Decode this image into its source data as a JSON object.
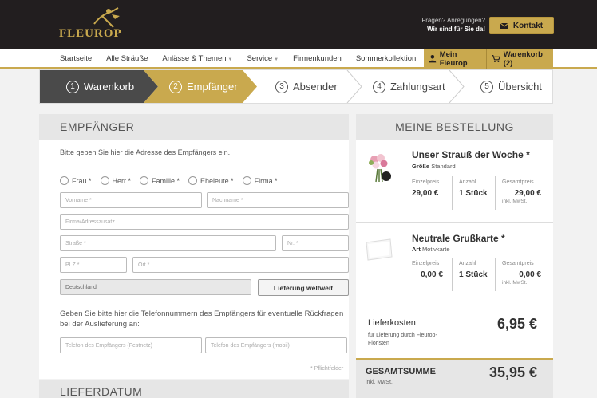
{
  "header": {
    "brand": "FLEUROP",
    "help_line1": "Fragen? Anregungen?",
    "help_line2": "Wir sind für Sie da!",
    "kontakt_label": "Kontakt"
  },
  "nav": {
    "items": [
      {
        "label": "Startseite"
      },
      {
        "label": "Alle Sträuße"
      },
      {
        "label": "Anlässe & Themen"
      },
      {
        "label": "Service"
      },
      {
        "label": "Firmenkunden"
      },
      {
        "label": "Sommerkollektion"
      }
    ],
    "my_account": "Mein Fleurop",
    "cart": "Warenkorb (2)"
  },
  "steps": [
    {
      "num": "1",
      "label": "Warenkorb",
      "state": "done"
    },
    {
      "num": "2",
      "label": "Empfänger",
      "state": "active"
    },
    {
      "num": "3",
      "label": "Absender",
      "state": "todo"
    },
    {
      "num": "4",
      "label": "Zahlungsart",
      "state": "todo"
    },
    {
      "num": "5",
      "label": "Übersicht",
      "state": "todo"
    }
  ],
  "recipient": {
    "heading": "EMPFÄNGER",
    "intro": "Bitte geben Sie hier die Adresse des Empfängers ein.",
    "salutations": [
      "Frau *",
      "Herr *",
      "Familie *",
      "Eheleute *",
      "Firma *"
    ],
    "placeholders": {
      "firstname": "Vorname *",
      "lastname": "Nachname *",
      "company": "Firma/Adresszusatz",
      "street": "Straße *",
      "number": "Nr. *",
      "zip": "PLZ *",
      "city": "Ort *",
      "phone": "Telefon des Empfängers (Festnetz)",
      "mobile": "Telefon des Empfängers (mobil)"
    },
    "country": "Deutschland",
    "worldwide_button": "Lieferung weltweit",
    "phone_text": "Geben Sie bitte hier die Telefonnummern des Empfängers für eventuelle Rückfragen bei der Auslieferung an:",
    "required_note": "* Pflichtfelder",
    "next_heading": "LIEFERDATUM"
  },
  "order": {
    "heading": "MEINE BESTELLUNG",
    "items": [
      {
        "name": "Unser Strauß der Woche *",
        "attr_label": "Größe",
        "attr_value": "Standard",
        "unit_price_label": "Einzelpreis",
        "unit_price": "29,00 €",
        "qty_label": "Anzahl",
        "qty": "1 Stück",
        "total_label": "Gesamtpreis",
        "total": "29,00 €",
        "tax": "inkl. MwSt."
      },
      {
        "name": "Neutrale Grußkarte *",
        "attr_label": "Art",
        "attr_value": "Motivkarte",
        "unit_price_label": "Einzelpreis",
        "unit_price": "0,00 €",
        "qty_label": "Anzahl",
        "qty": "1 Stück",
        "total_label": "Gesamtpreis",
        "total": "0,00 €",
        "tax": "inkl. MwSt."
      }
    ],
    "delivery_label": "Lieferkosten",
    "delivery_sub": "für Lieferung durch Fleurop-Floristen",
    "delivery_value": "6,95 €",
    "total_label": "GESAMTSUMME",
    "total_sub": "inkl. MwSt.",
    "total_value": "35,95 €"
  },
  "colors": {
    "gold": "#c9a94e",
    "dark": "#221e1f",
    "done_step": "#4a4a4a"
  }
}
